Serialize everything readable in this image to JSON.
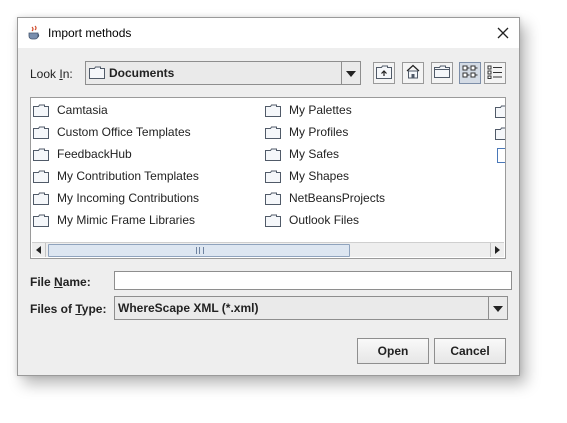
{
  "window": {
    "title": "Import methods",
    "app_icon": "java-cup-icon",
    "close_icon": "close-icon"
  },
  "look_in": {
    "label_pre": "Look ",
    "label_mnemonic": "I",
    "label_post": "n:",
    "value": "Documents"
  },
  "toolbar": {
    "buttons": [
      "up-one-level-icon",
      "home-icon",
      "new-folder-icon",
      "list-view-icon",
      "details-view-icon"
    ],
    "selected": "list-view-icon"
  },
  "files": {
    "column1": [
      "Camtasia",
      "Custom Office Templates",
      "FeedbackHub",
      "My Contribution Templates",
      "My Incoming Contributions",
      "My Mimic Frame Libraries"
    ],
    "column2": [
      "My Palettes",
      "My Profiles",
      "My Safes",
      "My Shapes",
      "NetBeansProjects",
      "Outlook Files"
    ]
  },
  "file_name": {
    "label_pre": "File ",
    "label_mnemonic": "N",
    "label_post": "ame:",
    "value": "",
    "placeholder": ""
  },
  "file_type": {
    "label_pre": "Files of ",
    "label_mnemonic": "T",
    "label_post": "ype:",
    "value": "WhereScape XML (*.xml)"
  },
  "buttons": {
    "open": "Open",
    "cancel": "Cancel"
  },
  "colors": {
    "dialog_bg": "#eeeeee",
    "scroll_thumb": "#dde6f1",
    "selected_toggle": "#d4dbe5",
    "folder_fill": "#f5f7fa"
  }
}
